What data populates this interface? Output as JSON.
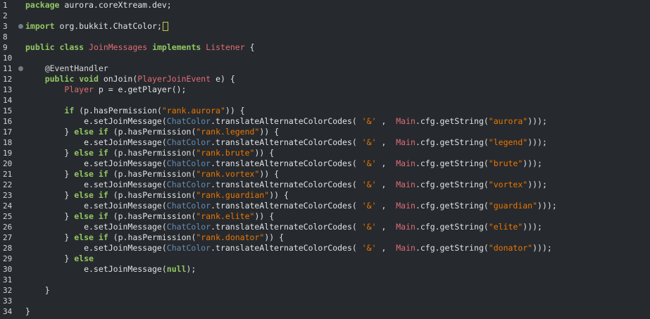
{
  "editor": {
    "lines": [
      {
        "n": "1",
        "tokens": [
          [
            "kw",
            "package"
          ],
          [
            "plain",
            " aurora.coreXtream.dev;"
          ]
        ]
      },
      {
        "n": "2",
        "tokens": []
      },
      {
        "n": "3",
        "fold": true,
        "tokens": [
          [
            "kw",
            "import"
          ],
          [
            "plain",
            " org.bukkit.ChatColor;"
          ]
        ],
        "caret": true
      },
      {
        "n": "8",
        "tokens": []
      },
      {
        "n": "9",
        "tokens": [
          [
            "kw",
            "public"
          ],
          [
            "plain",
            " "
          ],
          [
            "kw",
            "class"
          ],
          [
            "plain",
            " "
          ],
          [
            "red",
            "JoinMessages"
          ],
          [
            "plain",
            " "
          ],
          [
            "kw",
            "implements"
          ],
          [
            "plain",
            " "
          ],
          [
            "red",
            "Listener"
          ],
          [
            "plain",
            " {"
          ]
        ]
      },
      {
        "n": "10",
        "tokens": []
      },
      {
        "n": "11",
        "fold": true,
        "tokens": [
          [
            "plain",
            "    "
          ],
          [
            "ann",
            "@EventHandler"
          ]
        ]
      },
      {
        "n": "12",
        "tokens": [
          [
            "plain",
            "    "
          ],
          [
            "kw",
            "public"
          ],
          [
            "plain",
            " "
          ],
          [
            "kw",
            "void"
          ],
          [
            "plain",
            " onJoin("
          ],
          [
            "red",
            "PlayerJoinEvent"
          ],
          [
            "plain",
            " e) {"
          ]
        ]
      },
      {
        "n": "13",
        "tokens": [
          [
            "plain",
            "        "
          ],
          [
            "red",
            "Player"
          ],
          [
            "plain",
            " p = e.getPlayer();"
          ]
        ]
      },
      {
        "n": "14",
        "tokens": []
      },
      {
        "n": "15",
        "tokens": [
          [
            "plain",
            "        "
          ],
          [
            "kw",
            "if"
          ],
          [
            "plain",
            " (p.hasPermission("
          ],
          [
            "str",
            "\"rank.aurora\""
          ],
          [
            "plain",
            ")) {"
          ]
        ]
      },
      {
        "n": "16",
        "tokens": [
          [
            "plain",
            "            e.setJoinMessage("
          ],
          [
            "cls",
            "ChatColor"
          ],
          [
            "plain",
            ".translateAlternateColorCodes( "
          ],
          [
            "str",
            "'&'"
          ],
          [
            "plain",
            " ,  "
          ],
          [
            "red",
            "Main"
          ],
          [
            "plain",
            ".cfg.getString("
          ],
          [
            "str",
            "\"aurora\""
          ],
          [
            "plain",
            ")));"
          ]
        ]
      },
      {
        "n": "17",
        "tokens": [
          [
            "plain",
            "        } "
          ],
          [
            "kw",
            "else"
          ],
          [
            "plain",
            " "
          ],
          [
            "kw",
            "if"
          ],
          [
            "plain",
            " (p.hasPermission("
          ],
          [
            "str",
            "\"rank.legend\""
          ],
          [
            "plain",
            ")) {"
          ]
        ]
      },
      {
        "n": "18",
        "tokens": [
          [
            "plain",
            "            e.setJoinMessage("
          ],
          [
            "cls",
            "ChatColor"
          ],
          [
            "plain",
            ".translateAlternateColorCodes( "
          ],
          [
            "str",
            "'&'"
          ],
          [
            "plain",
            " ,  "
          ],
          [
            "red",
            "Main"
          ],
          [
            "plain",
            ".cfg.getString("
          ],
          [
            "str",
            "\"legend\""
          ],
          [
            "plain",
            ")));"
          ]
        ]
      },
      {
        "n": "19",
        "tokens": [
          [
            "plain",
            "        } "
          ],
          [
            "kw",
            "else"
          ],
          [
            "plain",
            " "
          ],
          [
            "kw",
            "if"
          ],
          [
            "plain",
            " (p.hasPermission("
          ],
          [
            "str",
            "\"rank.brute\""
          ],
          [
            "plain",
            ")) {"
          ]
        ]
      },
      {
        "n": "20",
        "tokens": [
          [
            "plain",
            "            e.setJoinMessage("
          ],
          [
            "cls",
            "ChatColor"
          ],
          [
            "plain",
            ".translateAlternateColorCodes( "
          ],
          [
            "str",
            "'&'"
          ],
          [
            "plain",
            " ,  "
          ],
          [
            "red",
            "Main"
          ],
          [
            "plain",
            ".cfg.getString("
          ],
          [
            "str",
            "\"brute\""
          ],
          [
            "plain",
            ")));"
          ]
        ]
      },
      {
        "n": "21",
        "tokens": [
          [
            "plain",
            "        } "
          ],
          [
            "kw",
            "else"
          ],
          [
            "plain",
            " "
          ],
          [
            "kw",
            "if"
          ],
          [
            "plain",
            " (p.hasPermission("
          ],
          [
            "str",
            "\"rank.vortex\""
          ],
          [
            "plain",
            ")) {"
          ]
        ]
      },
      {
        "n": "22",
        "tokens": [
          [
            "plain",
            "            e.setJoinMessage("
          ],
          [
            "cls",
            "ChatColor"
          ],
          [
            "plain",
            ".translateAlternateColorCodes( "
          ],
          [
            "str",
            "'&'"
          ],
          [
            "plain",
            " ,  "
          ],
          [
            "red",
            "Main"
          ],
          [
            "plain",
            ".cfg.getString("
          ],
          [
            "str",
            "\"vortex\""
          ],
          [
            "plain",
            ")));"
          ]
        ]
      },
      {
        "n": "23",
        "tokens": [
          [
            "plain",
            "        } "
          ],
          [
            "kw",
            "else"
          ],
          [
            "plain",
            " "
          ],
          [
            "kw",
            "if"
          ],
          [
            "plain",
            " (p.hasPermission("
          ],
          [
            "str",
            "\"rank.guardian\""
          ],
          [
            "plain",
            ")) {"
          ]
        ]
      },
      {
        "n": "24",
        "tokens": [
          [
            "plain",
            "            e.setJoinMessage("
          ],
          [
            "cls",
            "ChatColor"
          ],
          [
            "plain",
            ".translateAlternateColorCodes( "
          ],
          [
            "str",
            "'&'"
          ],
          [
            "plain",
            " ,  "
          ],
          [
            "red",
            "Main"
          ],
          [
            "plain",
            ".cfg.getString("
          ],
          [
            "str",
            "\"guardian\""
          ],
          [
            "plain",
            ")));"
          ]
        ]
      },
      {
        "n": "25",
        "tokens": [
          [
            "plain",
            "        } "
          ],
          [
            "kw",
            "else"
          ],
          [
            "plain",
            " "
          ],
          [
            "kw",
            "if"
          ],
          [
            "plain",
            " (p.hasPermission("
          ],
          [
            "str",
            "\"rank.elite\""
          ],
          [
            "plain",
            ")) {"
          ]
        ]
      },
      {
        "n": "26",
        "tokens": [
          [
            "plain",
            "            e.setJoinMessage("
          ],
          [
            "cls",
            "ChatColor"
          ],
          [
            "plain",
            ".translateAlternateColorCodes( "
          ],
          [
            "str",
            "'&'"
          ],
          [
            "plain",
            " ,  "
          ],
          [
            "red",
            "Main"
          ],
          [
            "plain",
            ".cfg.getString("
          ],
          [
            "str",
            "\"elite\""
          ],
          [
            "plain",
            ")));"
          ]
        ]
      },
      {
        "n": "27",
        "tokens": [
          [
            "plain",
            "        } "
          ],
          [
            "kw",
            "else"
          ],
          [
            "plain",
            " "
          ],
          [
            "kw",
            "if"
          ],
          [
            "plain",
            " (p.hasPermission("
          ],
          [
            "str",
            "\"rank.donator\""
          ],
          [
            "plain",
            ")) {"
          ]
        ]
      },
      {
        "n": "28",
        "tokens": [
          [
            "plain",
            "            e.setJoinMessage("
          ],
          [
            "cls",
            "ChatColor"
          ],
          [
            "plain",
            ".translateAlternateColorCodes( "
          ],
          [
            "str",
            "'&'"
          ],
          [
            "plain",
            " ,  "
          ],
          [
            "red",
            "Main"
          ],
          [
            "plain",
            ".cfg.getString("
          ],
          [
            "str",
            "\"donator\""
          ],
          [
            "plain",
            ")));"
          ]
        ]
      },
      {
        "n": "29",
        "tokens": [
          [
            "plain",
            "        } "
          ],
          [
            "kw",
            "else"
          ]
        ]
      },
      {
        "n": "30",
        "tokens": [
          [
            "plain",
            "            e.setJoinMessage("
          ],
          [
            "kw",
            "null"
          ],
          [
            "plain",
            ");"
          ]
        ]
      },
      {
        "n": "31",
        "tokens": []
      },
      {
        "n": "32",
        "tokens": [
          [
            "plain",
            "    }"
          ]
        ]
      },
      {
        "n": "33",
        "tokens": []
      },
      {
        "n": "34",
        "tokens": [
          [
            "plain",
            "}"
          ]
        ]
      }
    ]
  },
  "colors": {
    "background": "#262a2e",
    "keyword": "#93c763",
    "string": "#ec7600",
    "class": "#678cb1",
    "type": "#e06c75",
    "text": "#e0e2e4"
  }
}
